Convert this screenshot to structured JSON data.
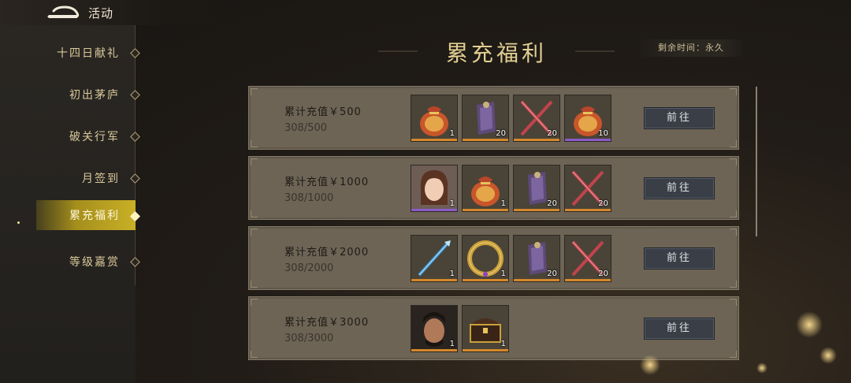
{
  "topbar": {
    "title": "活动"
  },
  "sidebar": {
    "items": [
      {
        "label": "十四日献礼",
        "active": false
      },
      {
        "label": "初出茅庐",
        "active": false
      },
      {
        "label": "破关行军",
        "active": false
      },
      {
        "label": "月签到",
        "active": false
      },
      {
        "label": "累充福利",
        "active": true
      },
      {
        "label": "等级嘉赏",
        "active": false
      }
    ]
  },
  "main": {
    "title": "累充福利",
    "remaining": "剩余时间：永久",
    "rows": [
      {
        "condition": "累计充值￥500",
        "progress": "308/500",
        "button": "前往",
        "rewards": [
          {
            "icon": "treasure-bag-icon",
            "count": "1",
            "rarity": "orange"
          },
          {
            "icon": "purple-token-icon",
            "count": "20",
            "rarity": "orange"
          },
          {
            "icon": "crossed-swords-icon",
            "count": "20",
            "rarity": "orange"
          },
          {
            "icon": "treasure-bag-icon",
            "count": "10",
            "rarity": "purple"
          }
        ]
      },
      {
        "condition": "累计充值￥1000",
        "progress": "308/1000",
        "button": "前往",
        "rewards": [
          {
            "icon": "female-hero-portrait-icon",
            "count": "1",
            "rarity": "purple"
          },
          {
            "icon": "treasure-bag-icon",
            "count": "1",
            "rarity": "orange"
          },
          {
            "icon": "purple-token-icon",
            "count": "20",
            "rarity": "orange"
          },
          {
            "icon": "crossed-swords-icon",
            "count": "20",
            "rarity": "orange"
          }
        ]
      },
      {
        "condition": "累计充值￥2000",
        "progress": "308/2000",
        "button": "前往",
        "rewards": [
          {
            "icon": "crystal-spear-icon",
            "count": "1",
            "rarity": "orange"
          },
          {
            "icon": "dragon-ring-icon",
            "count": "1",
            "rarity": "orange"
          },
          {
            "icon": "purple-token-icon",
            "count": "20",
            "rarity": "orange"
          },
          {
            "icon": "crossed-swords-icon",
            "count": "20",
            "rarity": "orange"
          }
        ]
      },
      {
        "condition": "累计充值￥3000",
        "progress": "308/3000",
        "button": "前往",
        "rewards": [
          {
            "icon": "male-hero-portrait-icon",
            "count": "1",
            "rarity": "orange"
          },
          {
            "icon": "treasure-chest-icon",
            "count": "1",
            "rarity": "orange"
          }
        ]
      }
    ]
  },
  "colors": {
    "accent": "#c9b027",
    "title_gold": "#e3cf93",
    "row_bg": "#6d6456",
    "button_bg": "#3a3f47",
    "rarity_orange": "#d4882b",
    "rarity_purple": "#8a5bc9"
  }
}
